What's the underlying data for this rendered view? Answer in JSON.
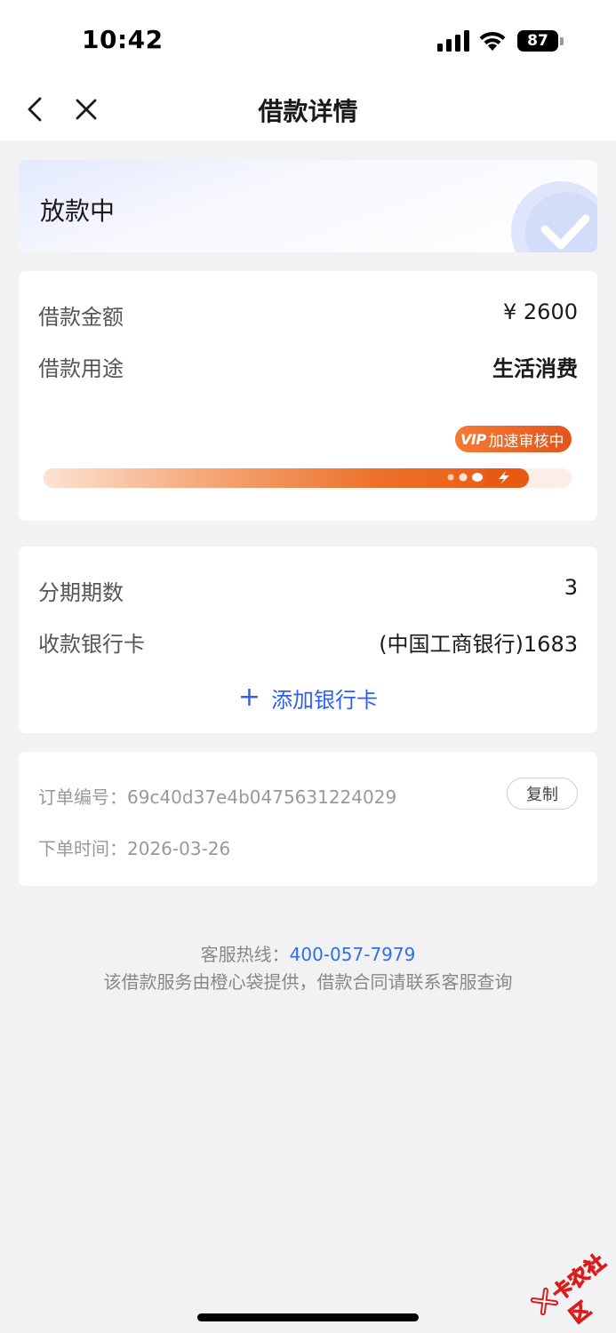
{
  "status_bar": {
    "time": "10:42",
    "battery": "87",
    "icons": [
      "cellular-signal-icon",
      "wifi-icon",
      "battery-icon"
    ]
  },
  "nav": {
    "title": "借款详情",
    "icons": [
      "back-chevron-icon",
      "close-icon"
    ]
  },
  "loan_status": {
    "text": "放款中",
    "icon": "check-circle-icon"
  },
  "loan_info": {
    "amount_label": "借款金额",
    "amount_value": "¥ 2600",
    "purpose_label": "借款用途",
    "purpose_value": "生活消费",
    "progress": {
      "badge_mark": "VIP",
      "badge_text": "加速审核中",
      "fraction": 0.92
    }
  },
  "installment": {
    "periods_label": "分期期数",
    "periods_value": "3",
    "bank_label": "收款银行卡",
    "bank_value": "(中国工商银行)1683",
    "add_card_label": "添加银行卡",
    "add_icon": "plus-icon"
  },
  "order": {
    "number_label": "订单编号：",
    "number_value": "69c40d37e4b0475631224029",
    "copy_label": "复制",
    "time_label": "下单时间：",
    "time_value": "2026-03-26"
  },
  "footer": {
    "hotline_label": "客服热线：",
    "hotline_number": "400-057-7979",
    "notice": "该借款服务由橙心袋提供，借款合同请联系客服查询"
  },
  "watermark": {
    "text": "卡农社区"
  },
  "colors": {
    "accent_blue": "#2f5ff0",
    "link_blue": "#2f6fe8",
    "progress_orange": "#e85a14",
    "page_bg": "#f2f2f4"
  }
}
